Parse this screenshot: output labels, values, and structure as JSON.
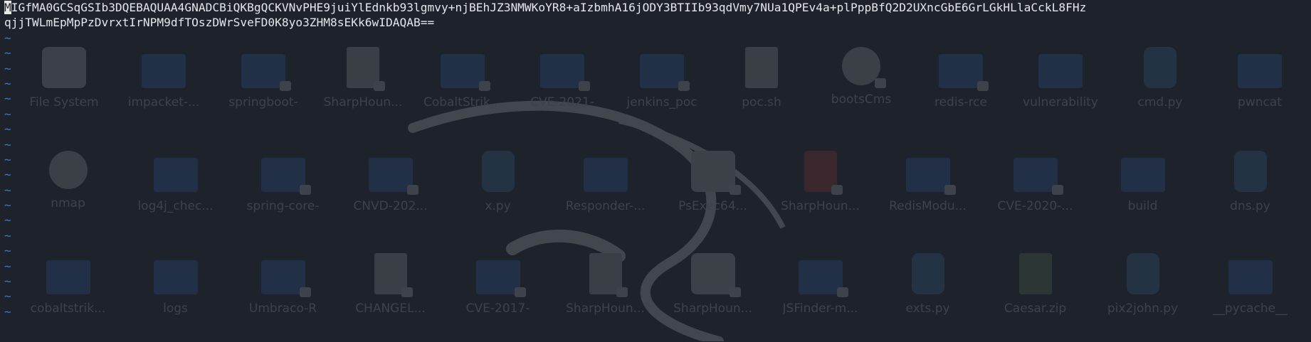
{
  "editor": {
    "cursor_char": "M",
    "lines": [
      "IGfMA0GCSqGSIb3DQEBAQUAA4GNADCBiQKBgQCKVNvPHE9juiYlEdnkb93lgmvy+njBEhJZ3NMWKoYR8+aIzbmhA16jODY3BTIIb93qdVmy7NUa1QPEv4a+plPppBfQ2D2UXncGbE6GrLGkHLlaCckL8FHz",
      "qjjTWLmEpMpPzDvrxtIrNPM9dfTOszDWrSveFD0K8yo3ZHM8sEKk6wIDAQAB=="
    ],
    "empty_line_marker": "~",
    "empty_line_count": 19
  },
  "desktop": {
    "row1": [
      {
        "label": "File System",
        "icon": "drive-icon"
      },
      {
        "label": "impacket-...",
        "icon": "folder-icon"
      },
      {
        "label": "springboot-",
        "icon": "locked-folder-icon"
      },
      {
        "label": "SharpHoun...",
        "icon": "locked-file-icon"
      },
      {
        "label": "CobaltStrik...",
        "icon": "locked-folder-icon"
      },
      {
        "label": "CVE-2021-",
        "icon": "locked-folder-icon"
      },
      {
        "label": "jenkins_poc",
        "icon": "locked-folder-icon"
      },
      {
        "label": "poc.sh",
        "icon": "file-icon"
      },
      {
        "label": "bootsCms",
        "icon": "locked-gear-icon"
      },
      {
        "label": "redis-rce",
        "icon": "locked-folder-icon"
      },
      {
        "label": "vulnerability",
        "icon": "folder-icon"
      },
      {
        "label": "cmd.py",
        "icon": "python-file-icon"
      },
      {
        "label": "pwncat",
        "icon": "folder-icon"
      }
    ],
    "row2": [
      {
        "label": "nmap",
        "icon": "gear-icon"
      },
      {
        "label": "log4j_chec...",
        "icon": "folder-icon"
      },
      {
        "label": "spring-core-",
        "icon": "locked-folder-icon"
      },
      {
        "label": "CNVD-202...",
        "icon": "locked-folder-icon"
      },
      {
        "label": "x.py",
        "icon": "python-file-icon"
      },
      {
        "label": "Responder-...",
        "icon": "folder-icon"
      },
      {
        "label": "PsExec64...",
        "icon": "locked-drive-icon"
      },
      {
        "label": "SharpHoun...",
        "icon": "locked-red-icon"
      },
      {
        "label": "RedisModu...",
        "icon": "locked-folder-icon"
      },
      {
        "label": "CVE-2020-...",
        "icon": "locked-folder-icon"
      },
      {
        "label": "build",
        "icon": "folder-icon"
      },
      {
        "label": "dns.py",
        "icon": "python-file-icon"
      }
    ],
    "row3": [
      {
        "label": "cobaltstrik...",
        "icon": "folder-icon"
      },
      {
        "label": "logs",
        "icon": "folder-icon"
      },
      {
        "label": "Umbraco-R",
        "icon": "locked-folder-icon"
      },
      {
        "label": "CHANGEL...",
        "icon": "locked-file-icon"
      },
      {
        "label": "CVE-2017-",
        "icon": "locked-folder-icon"
      },
      {
        "label": "SharpHoun...",
        "icon": "locked-file-icon"
      },
      {
        "label": "SharpHoun...",
        "icon": "locked-drive-icon"
      },
      {
        "label": "JSFinder-m...",
        "icon": "locked-folder-icon"
      },
      {
        "label": "exts.py",
        "icon": "python-file-icon"
      },
      {
        "label": "Caesar.zip",
        "icon": "zip-icon"
      },
      {
        "label": "pix2john.py",
        "icon": "python-file-icon"
      },
      {
        "label": "__pycache__",
        "icon": "folder-icon"
      }
    ]
  },
  "colors": {
    "background": "#1d222b",
    "text": "#e4e6ea",
    "tilde": "#3a7bd5",
    "cursor": "#e8e8e8"
  }
}
